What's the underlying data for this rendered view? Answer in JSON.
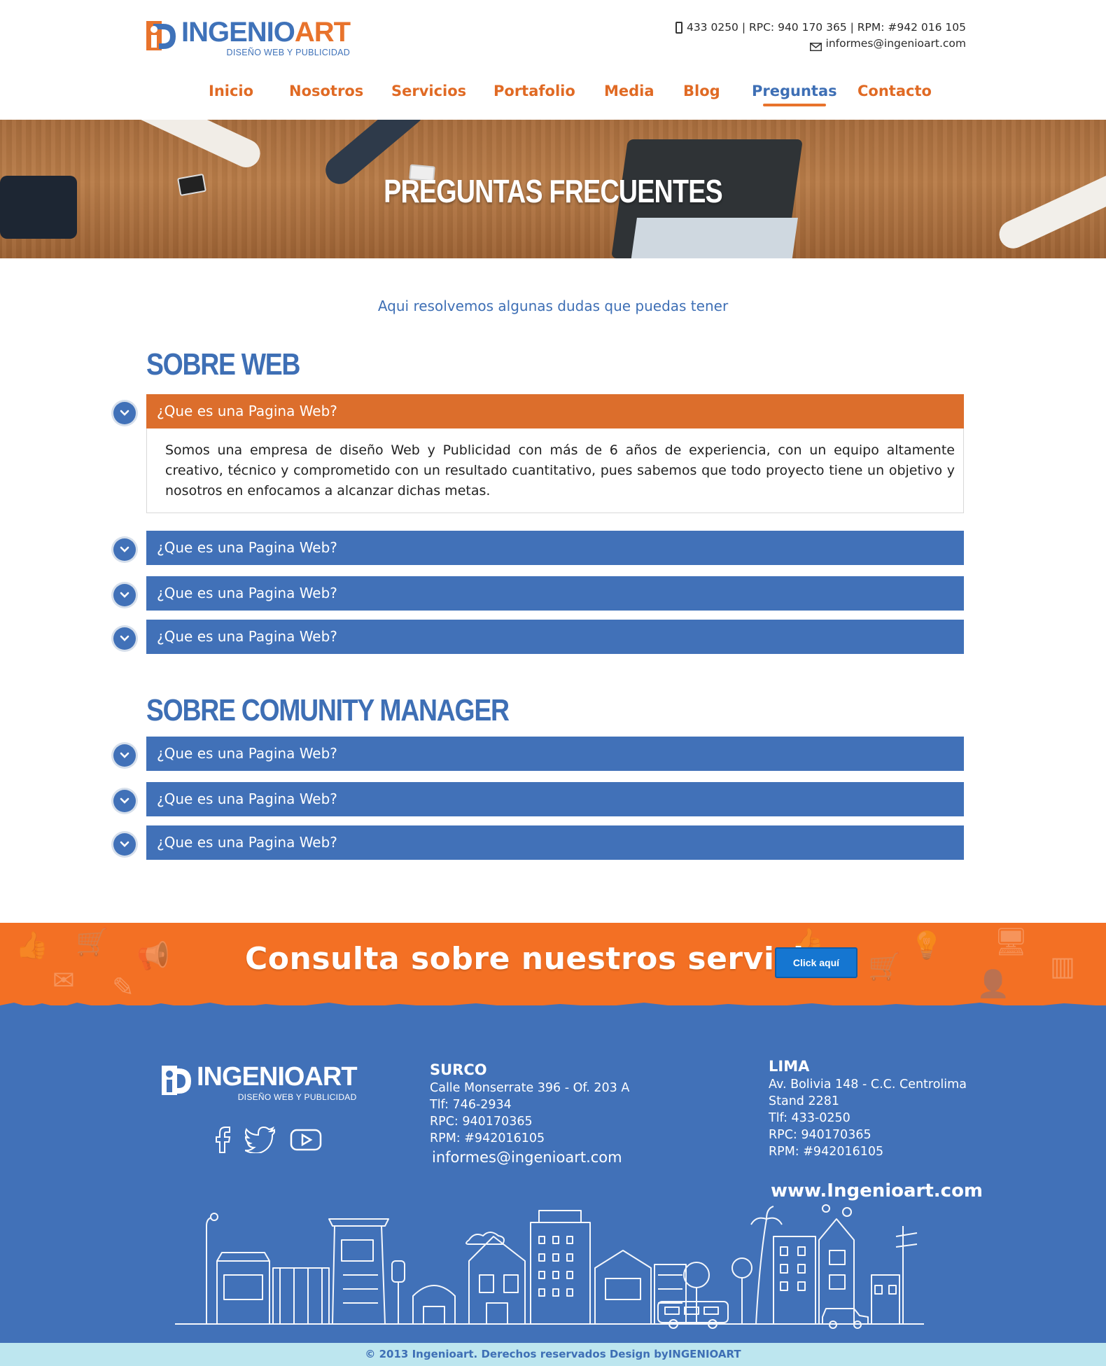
{
  "header": {
    "logo": {
      "name_part1": "INGENIO",
      "name_part2": "ART",
      "tagline": "DISEÑO WEB Y PUBLICIDAD"
    },
    "contact": {
      "phone_line": "433 0250 | RPC: 940 170 365 | RPM: #942 016 105",
      "email": "informes@ingenioart.com"
    },
    "nav": [
      {
        "label": "Inicio"
      },
      {
        "label": "Nosotros"
      },
      {
        "label": "Servicios"
      },
      {
        "label": "Portafolio"
      },
      {
        "label": "Media"
      },
      {
        "label": "Blog"
      },
      {
        "label": "Preguntas",
        "active": true
      },
      {
        "label": "Contacto"
      }
    ]
  },
  "hero": {
    "title": "PREGUNTAS FRECUENTES"
  },
  "intro": "Aqui resolvemos algunas dudas que puedas tener",
  "sections": [
    {
      "title": "SOBRE WEB",
      "faqs": [
        {
          "question": "¿Que es una Pagina Web?",
          "open": true,
          "answer": "Somos una empresa de diseño Web y Publicidad con más de 6 años de experiencia, con un equipo altamente creativo, técnico y comprometido con un resultado cuantitativo, pues sabemos que todo proyecto tiene un objetivo y nosotros en enfocamos a alcanzar dichas metas."
        },
        {
          "question": "¿Que es una Pagina Web?"
        },
        {
          "question": "¿Que es una Pagina Web?"
        },
        {
          "question": "¿Que es una Pagina Web?"
        }
      ]
    },
    {
      "title": "SOBRE COMUNITY MANAGER",
      "faqs": [
        {
          "question": "¿Que es una Pagina Web?"
        },
        {
          "question": "¿Que es una Pagina Web?"
        },
        {
          "question": "¿Que es una Pagina Web?"
        }
      ]
    }
  ],
  "cta": {
    "text": "Consulta sobre nuestros servicios",
    "button": "Click aquí"
  },
  "footer": {
    "logo": {
      "name": "INGENIOART",
      "tagline": "DISEÑO WEB Y PUBLICIDAD"
    },
    "social_icons": [
      "facebook-icon",
      "twitter-icon",
      "youtube-icon"
    ],
    "surco": {
      "name": "SURCO",
      "address": "Calle Monserrate 396 - Of. 203 A",
      "tlf": "Tlf: 746-2934",
      "rpc": "RPC: 940170365",
      "rpm": "RPM: #942016105",
      "email": "informes@ingenioart.com"
    },
    "lima": {
      "name": "LIMA",
      "address": "Av. Bolivia 148 - C.C. Centrolima",
      "stand": "Stand 2281",
      "tlf": "Tlf: 433-0250",
      "rpc": "RPC: 940170365",
      "rpm": "RPM: #942016105"
    },
    "website": "www.Ingenioart.com"
  },
  "copyright": "© 2013 Ingenioart. Derechos reservados Design byINGENIOART",
  "colors": {
    "brand_blue": "#4171b8",
    "brand_orange": "#e8732c",
    "cta_orange": "#f37024",
    "copyright_bg": "#bde6ef"
  }
}
